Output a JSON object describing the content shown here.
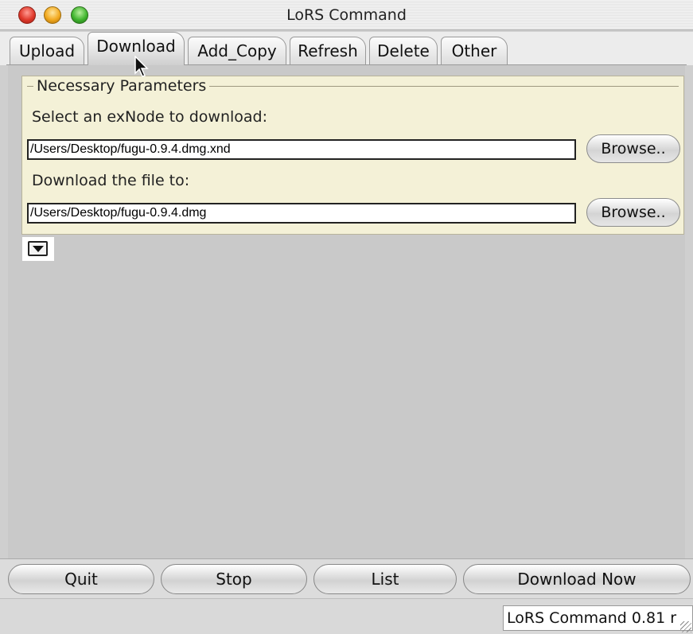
{
  "window": {
    "title": "LoRS Command"
  },
  "tabs": [
    {
      "label": "Upload"
    },
    {
      "label": "Download"
    },
    {
      "label": "Add_Copy"
    },
    {
      "label": "Refresh"
    },
    {
      "label": "Delete"
    },
    {
      "label": "Other"
    }
  ],
  "active_tab": "Download",
  "params": {
    "legend": "Necessary Parameters",
    "exnode_label": "Select an exNode to download:",
    "exnode_value": "/Users/Desktop/fugu-0.9.4.dmg.xnd",
    "dest_label": "Download the file to:",
    "dest_value": "/Users/Desktop/fugu-0.9.4.dmg",
    "browse_label": "Browse.."
  },
  "buttons": {
    "quit": "Quit",
    "stop": "Stop",
    "list": "List",
    "download_now": "Download Now"
  },
  "status": {
    "text": "LoRS Command 0.81 r"
  },
  "icons": {
    "close": "close-icon",
    "minimize": "minimize-icon",
    "zoom": "zoom-icon",
    "disclosure": "disclosure-triangle-icon",
    "cursor": "mouse-pointer-icon"
  }
}
